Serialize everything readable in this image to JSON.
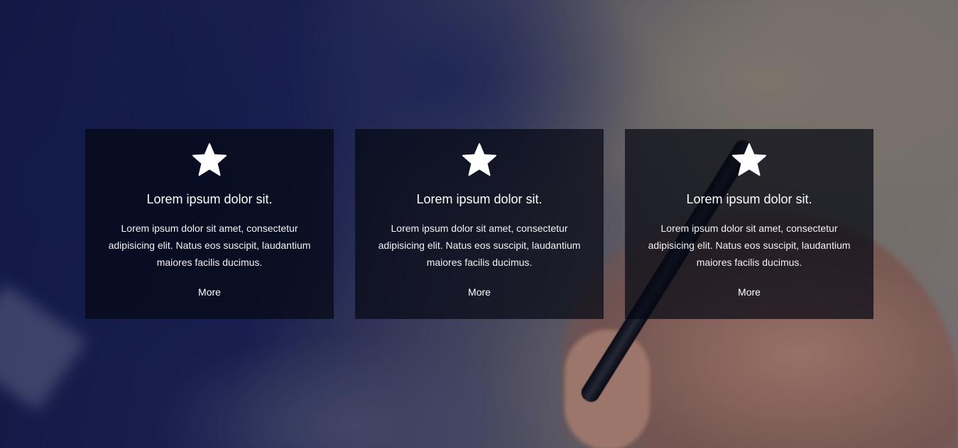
{
  "cards": [
    {
      "icon": "star-icon",
      "title": "Lorem ipsum dolor sit.",
      "text": "Lorem ipsum dolor sit amet, consectetur adipisicing elit. Natus eos suscipit, laudantium maiores facilis ducimus.",
      "link_label": "More"
    },
    {
      "icon": "star-icon",
      "title": "Lorem ipsum dolor sit.",
      "text": "Lorem ipsum dolor sit amet, consectetur adipisicing elit. Natus eos suscipit, laudantium maiores facilis ducimus.",
      "link_label": "More"
    },
    {
      "icon": "star-icon",
      "title": "Lorem ipsum dolor sit.",
      "text": "Lorem ipsum dolor sit amet, consectetur adipisicing elit. Natus eos suscipit, laudantium maiores facilis ducimus.",
      "link_label": "More"
    }
  ],
  "colors": {
    "card_background": "#05081480",
    "text": "#ffffff",
    "background_dark": "#141b4a",
    "background_light": "#8e8680"
  }
}
